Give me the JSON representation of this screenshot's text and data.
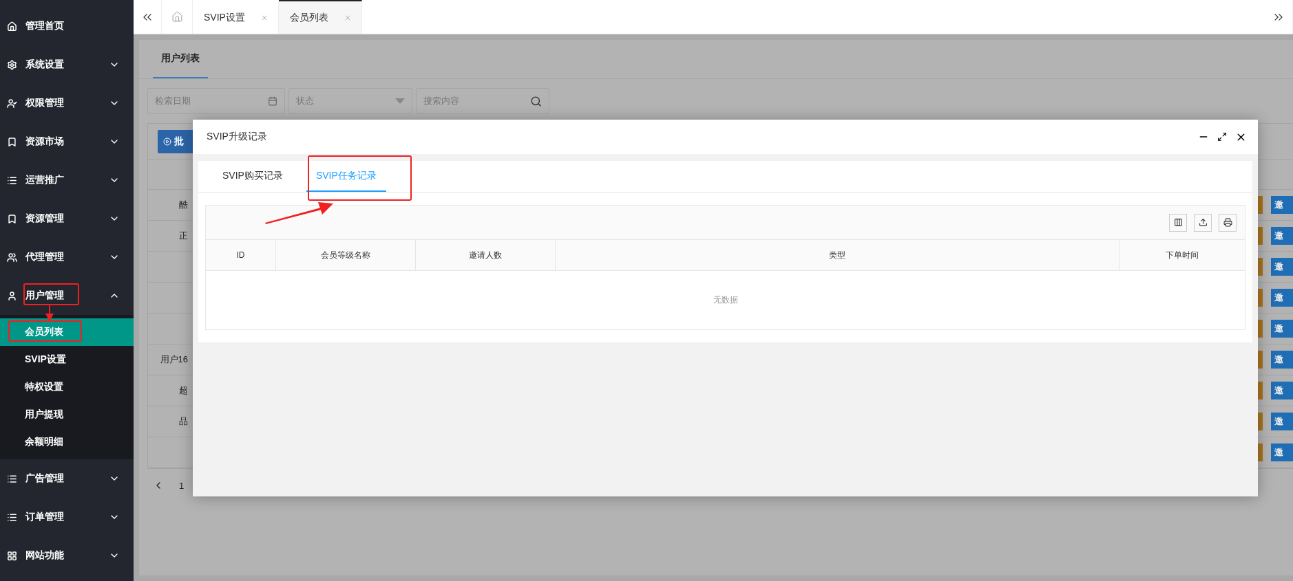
{
  "sidebar": {
    "items": [
      {
        "kind": "link",
        "label": "管理首页"
      },
      {
        "kind": "group",
        "label": "系统设置",
        "expanded": false
      },
      {
        "kind": "group",
        "label": "权限管理",
        "expanded": false
      },
      {
        "kind": "group",
        "label": "资源市场",
        "expanded": false
      },
      {
        "kind": "group",
        "label": "运营推广",
        "expanded": false
      },
      {
        "kind": "group",
        "label": "资源管理",
        "expanded": false
      },
      {
        "kind": "group",
        "label": "代理管理",
        "expanded": false
      },
      {
        "kind": "group",
        "label": "用户管理",
        "expanded": true,
        "children": [
          {
            "label": "会员列表",
            "selected": true
          },
          {
            "label": "SVIP设置",
            "selected": false
          },
          {
            "label": "特权设置",
            "selected": false
          },
          {
            "label": "用户提现",
            "selected": false
          },
          {
            "label": "余额明细",
            "selected": false
          }
        ]
      },
      {
        "kind": "group",
        "label": "广告管理",
        "expanded": false
      },
      {
        "kind": "group",
        "label": "订单管理",
        "expanded": false
      },
      {
        "kind": "group",
        "label": "网站功能",
        "expanded": false
      }
    ]
  },
  "top_tabs": [
    {
      "label": "SVIP设置",
      "selected": false
    },
    {
      "label": "会员列表",
      "selected": true
    }
  ],
  "page": {
    "tab": "用户列表",
    "filters": {
      "date_placeholder": "检索日期",
      "status_placeholder": "状态",
      "search_placeholder": "搜索内容"
    },
    "batch_button": "批",
    "rows": [
      {
        "name": "酷",
        "action": "邀"
      },
      {
        "name": "正",
        "action": "邀"
      },
      {
        "action": "邀"
      },
      {
        "action": "邀"
      },
      {
        "action": "邀"
      },
      {
        "name": "用户16",
        "action": "邀"
      },
      {
        "name": "超",
        "action": "邀"
      },
      {
        "name": "品",
        "action": "邀"
      },
      {
        "action": "邀"
      }
    ],
    "pagination": {
      "first_page": "1"
    }
  },
  "modal": {
    "title": "SVIP升级记录",
    "tabs": [
      {
        "label": "SVIP购买记录",
        "selected": false
      },
      {
        "label": "SVIP任务记录",
        "selected": true
      }
    ],
    "columns": [
      "ID",
      "会员等级名称",
      "邀请人数",
      "类型",
      "下单时间"
    ],
    "empty_text": "无数据"
  }
}
